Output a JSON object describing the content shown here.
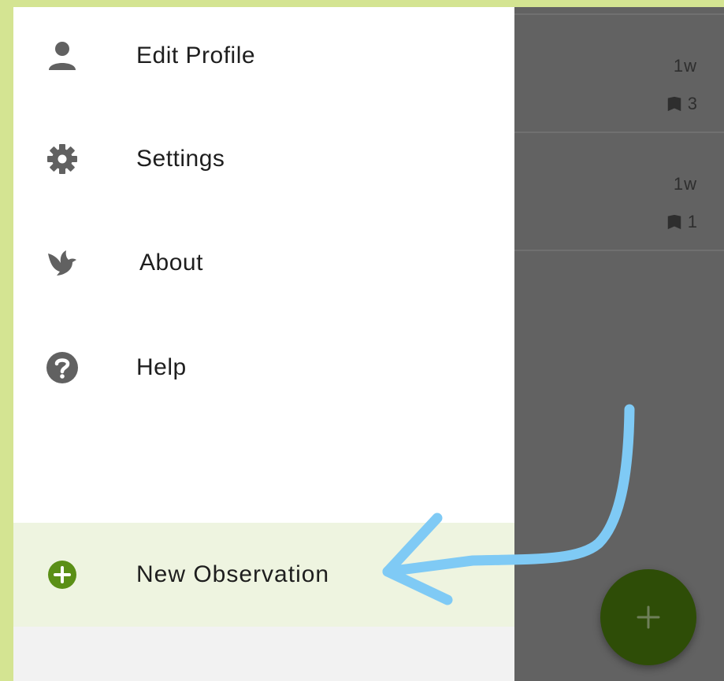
{
  "drawer": {
    "items": [
      {
        "label": "Edit Profile",
        "icon": "person-icon"
      },
      {
        "label": "Settings",
        "icon": "gear-icon"
      },
      {
        "label": "About",
        "icon": "bird-icon"
      },
      {
        "label": "Help",
        "icon": "help-icon"
      }
    ],
    "primary_action": {
      "label": "New Observation",
      "icon": "plus-circle-icon"
    }
  },
  "background_list": {
    "rows": [
      {
        "time": "1w",
        "count": "3"
      },
      {
        "time": "1w",
        "count": "1"
      }
    ]
  },
  "fab": {
    "icon": "plus-icon"
  },
  "colors": {
    "page_bg": "#d4e492",
    "accent_green": "#5a8f16",
    "highlight_row": "#eef4e0",
    "fab": "#2e4d07",
    "annotation_arrow": "#7fcaf5",
    "scrim": "#626262"
  }
}
